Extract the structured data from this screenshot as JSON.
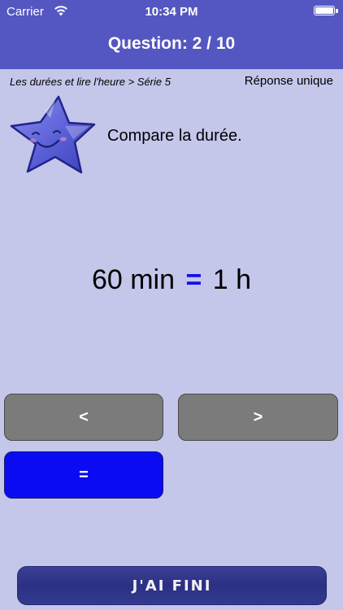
{
  "status_bar": {
    "carrier": "Carrier",
    "time": "10:34 PM"
  },
  "header": {
    "title": "Question: 2 / 10"
  },
  "breadcrumb": "Les durées et lire l'heure > Série 5",
  "mode_label": "Réponse unique",
  "instruction": "Compare la durée.",
  "expression": {
    "left": "60 min",
    "operator": "=",
    "right": "1 h"
  },
  "answers": {
    "less": "<",
    "greater": ">",
    "equal": "="
  },
  "done_label": "J'AI FINI",
  "colors": {
    "header": "#5456c1",
    "background": "#c4c6ea",
    "answer_grey": "#7b7b7b",
    "answer_selected": "#0b0bf2",
    "operator": "#1212e8"
  }
}
